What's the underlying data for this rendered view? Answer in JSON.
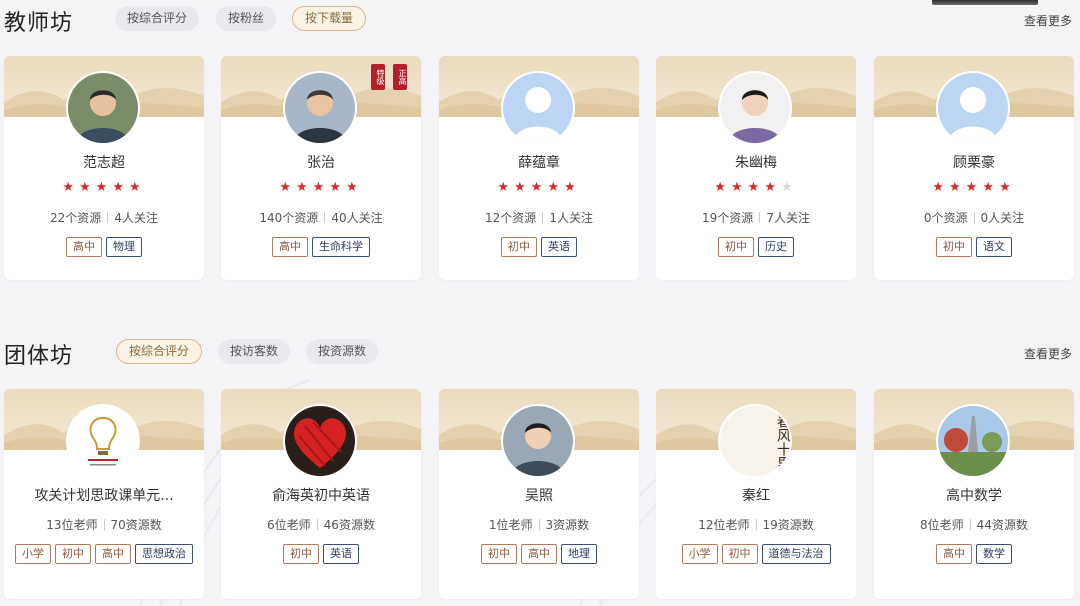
{
  "teacher_section": {
    "title": "教师坊",
    "sort_options": [
      "按综合评分",
      "按粉丝",
      "按下载量"
    ],
    "active_sort_index": 2,
    "more_label": "查看更多",
    "cards": [
      {
        "name": "范志超",
        "rating": 5,
        "stat1": "22个资源",
        "stat2": "4人关注",
        "level_tags": [
          "高中"
        ],
        "subject_tags": [
          "物理"
        ],
        "avatar_icon": "teacher-photo-icon"
      },
      {
        "name": "张治",
        "rating": 5,
        "stat1": "140个资源",
        "stat2": "40人关注",
        "level_tags": [
          "高中"
        ],
        "subject_tags": [
          "生命科学"
        ],
        "avatar_icon": "teacher-photo-icon",
        "seal_labels": [
          "特级",
          "正高"
        ]
      },
      {
        "name": "薛蕴章",
        "rating": 5,
        "stat1": "12个资源",
        "stat2": "1人关注",
        "level_tags": [
          "初中"
        ],
        "subject_tags": [
          "英语"
        ],
        "avatar_icon": "default-user-icon"
      },
      {
        "name": "朱幽梅",
        "rating": 4,
        "stat1": "19个资源",
        "stat2": "7人关注",
        "level_tags": [
          "初中"
        ],
        "subject_tags": [
          "历史"
        ],
        "avatar_icon": "teacher-photo-icon"
      },
      {
        "name": "顾栗豪",
        "rating": 5,
        "stat1": "0个资源",
        "stat2": "0人关注",
        "level_tags": [
          "初中"
        ],
        "subject_tags": [
          "语文"
        ],
        "avatar_icon": "default-user-icon"
      }
    ]
  },
  "group_section": {
    "title": "团体坊",
    "sort_options": [
      "按综合评分",
      "按访客数",
      "按资源数"
    ],
    "active_sort_index": 0,
    "more_label": "查看更多",
    "cards": [
      {
        "name": "攻关计划思政课单元...",
        "stat1": "13位老师",
        "stat2": "70资源数",
        "level_tags": [
          "小学",
          "初中",
          "高中"
        ],
        "subject_tags": [
          "思想政治"
        ],
        "avatar_icon": "lightbulb-logo-icon"
      },
      {
        "name": "俞海英初中英语",
        "stat1": "6位老师",
        "stat2": "46资源数",
        "level_tags": [
          "初中"
        ],
        "subject_tags": [
          "英语"
        ],
        "avatar_icon": "heart-logo-icon"
      },
      {
        "name": "吴照",
        "stat1": "1位老师",
        "stat2": "3资源数",
        "level_tags": [
          "初中",
          "高中"
        ],
        "subject_tags": [
          "地理"
        ],
        "avatar_icon": "teacher-photo-icon"
      },
      {
        "name": "秦红",
        "stat1": "12位老师",
        "stat2": "19资源数",
        "level_tags": [
          "小学",
          "初中"
        ],
        "subject_tags": [
          "道德与法治"
        ],
        "avatar_icon": "calligraphy-logo-icon",
        "logo_text": "春风十里"
      },
      {
        "name": "高中数学",
        "stat1": "8位老师",
        "stat2": "44资源数",
        "level_tags": [
          "高中"
        ],
        "subject_tags": [
          "数学"
        ],
        "avatar_icon": "photo-icon"
      }
    ]
  },
  "colors": {
    "star": "#d52b2b",
    "star_off": "#d6d6d6",
    "level_tag": "#8b5a40",
    "subject_tag": "#2d3f62",
    "active_pill_border": "#d9b98a",
    "banner": "#e6d5b2"
  }
}
